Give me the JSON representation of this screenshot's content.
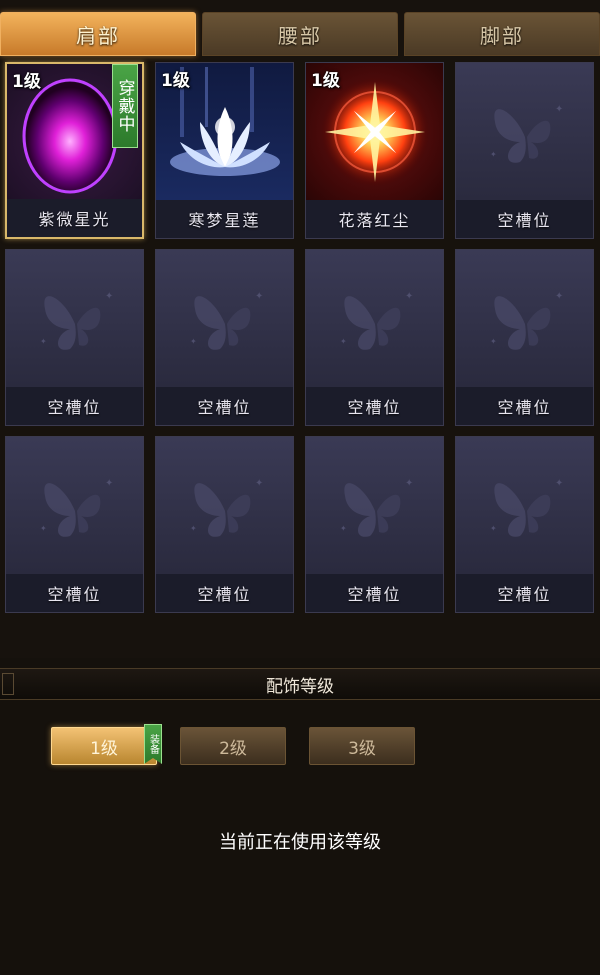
{
  "tabs": [
    {
      "label": "肩部",
      "active": true
    },
    {
      "label": "腰部",
      "active": false
    },
    {
      "label": "脚部",
      "active": false
    }
  ],
  "slots": [
    {
      "level": "1级",
      "name": "紫微星光",
      "wearing": "穿戴中",
      "art": "purple-orb-icon",
      "color": "#c020c8"
    },
    {
      "level": "1级",
      "name": "寒梦星莲",
      "art": "white-lotus-icon",
      "color": "#cfe0ff"
    },
    {
      "level": "1级",
      "name": "花落红尘",
      "art": "red-star-icon",
      "color": "#ff5a20"
    },
    {
      "name": "空槽位"
    },
    {
      "name": "空槽位"
    },
    {
      "name": "空槽位"
    },
    {
      "name": "空槽位"
    },
    {
      "name": "空槽位"
    },
    {
      "name": "空槽位"
    },
    {
      "name": "空槽位"
    },
    {
      "name": "空槽位"
    },
    {
      "name": "空槽位"
    }
  ],
  "panel": {
    "title": "配饰等级",
    "levels": [
      {
        "label": "1级",
        "active": true,
        "badge": "装备"
      },
      {
        "label": "2级",
        "active": false
      },
      {
        "label": "3级",
        "active": false
      }
    ],
    "status": "当前正在使用该等级"
  },
  "colors": {
    "accent": "#e9a24a",
    "badge_green": "#3f9a3c"
  }
}
